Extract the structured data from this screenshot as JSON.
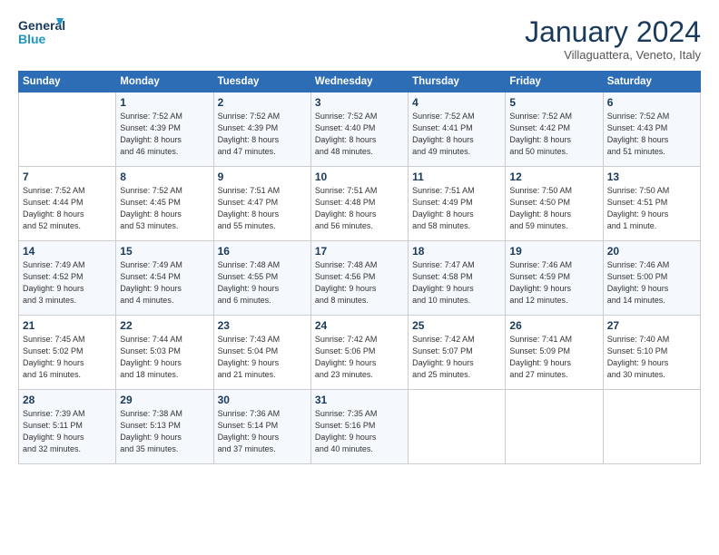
{
  "logo": {
    "line1": "General",
    "line2": "Blue"
  },
  "header": {
    "title": "January 2024",
    "subtitle": "Villaguattera, Veneto, Italy"
  },
  "weekdays": [
    "Sunday",
    "Monday",
    "Tuesday",
    "Wednesday",
    "Thursday",
    "Friday",
    "Saturday"
  ],
  "weeks": [
    [
      {
        "day": "",
        "info": ""
      },
      {
        "day": "1",
        "info": "Sunrise: 7:52 AM\nSunset: 4:39 PM\nDaylight: 8 hours\nand 46 minutes."
      },
      {
        "day": "2",
        "info": "Sunrise: 7:52 AM\nSunset: 4:39 PM\nDaylight: 8 hours\nand 47 minutes."
      },
      {
        "day": "3",
        "info": "Sunrise: 7:52 AM\nSunset: 4:40 PM\nDaylight: 8 hours\nand 48 minutes."
      },
      {
        "day": "4",
        "info": "Sunrise: 7:52 AM\nSunset: 4:41 PM\nDaylight: 8 hours\nand 49 minutes."
      },
      {
        "day": "5",
        "info": "Sunrise: 7:52 AM\nSunset: 4:42 PM\nDaylight: 8 hours\nand 50 minutes."
      },
      {
        "day": "6",
        "info": "Sunrise: 7:52 AM\nSunset: 4:43 PM\nDaylight: 8 hours\nand 51 minutes."
      }
    ],
    [
      {
        "day": "7",
        "info": "Sunrise: 7:52 AM\nSunset: 4:44 PM\nDaylight: 8 hours\nand 52 minutes."
      },
      {
        "day": "8",
        "info": "Sunrise: 7:52 AM\nSunset: 4:45 PM\nDaylight: 8 hours\nand 53 minutes."
      },
      {
        "day": "9",
        "info": "Sunrise: 7:51 AM\nSunset: 4:47 PM\nDaylight: 8 hours\nand 55 minutes."
      },
      {
        "day": "10",
        "info": "Sunrise: 7:51 AM\nSunset: 4:48 PM\nDaylight: 8 hours\nand 56 minutes."
      },
      {
        "day": "11",
        "info": "Sunrise: 7:51 AM\nSunset: 4:49 PM\nDaylight: 8 hours\nand 58 minutes."
      },
      {
        "day": "12",
        "info": "Sunrise: 7:50 AM\nSunset: 4:50 PM\nDaylight: 8 hours\nand 59 minutes."
      },
      {
        "day": "13",
        "info": "Sunrise: 7:50 AM\nSunset: 4:51 PM\nDaylight: 9 hours\nand 1 minute."
      }
    ],
    [
      {
        "day": "14",
        "info": "Sunrise: 7:49 AM\nSunset: 4:52 PM\nDaylight: 9 hours\nand 3 minutes."
      },
      {
        "day": "15",
        "info": "Sunrise: 7:49 AM\nSunset: 4:54 PM\nDaylight: 9 hours\nand 4 minutes."
      },
      {
        "day": "16",
        "info": "Sunrise: 7:48 AM\nSunset: 4:55 PM\nDaylight: 9 hours\nand 6 minutes."
      },
      {
        "day": "17",
        "info": "Sunrise: 7:48 AM\nSunset: 4:56 PM\nDaylight: 9 hours\nand 8 minutes."
      },
      {
        "day": "18",
        "info": "Sunrise: 7:47 AM\nSunset: 4:58 PM\nDaylight: 9 hours\nand 10 minutes."
      },
      {
        "day": "19",
        "info": "Sunrise: 7:46 AM\nSunset: 4:59 PM\nDaylight: 9 hours\nand 12 minutes."
      },
      {
        "day": "20",
        "info": "Sunrise: 7:46 AM\nSunset: 5:00 PM\nDaylight: 9 hours\nand 14 minutes."
      }
    ],
    [
      {
        "day": "21",
        "info": "Sunrise: 7:45 AM\nSunset: 5:02 PM\nDaylight: 9 hours\nand 16 minutes."
      },
      {
        "day": "22",
        "info": "Sunrise: 7:44 AM\nSunset: 5:03 PM\nDaylight: 9 hours\nand 18 minutes."
      },
      {
        "day": "23",
        "info": "Sunrise: 7:43 AM\nSunset: 5:04 PM\nDaylight: 9 hours\nand 21 minutes."
      },
      {
        "day": "24",
        "info": "Sunrise: 7:42 AM\nSunset: 5:06 PM\nDaylight: 9 hours\nand 23 minutes."
      },
      {
        "day": "25",
        "info": "Sunrise: 7:42 AM\nSunset: 5:07 PM\nDaylight: 9 hours\nand 25 minutes."
      },
      {
        "day": "26",
        "info": "Sunrise: 7:41 AM\nSunset: 5:09 PM\nDaylight: 9 hours\nand 27 minutes."
      },
      {
        "day": "27",
        "info": "Sunrise: 7:40 AM\nSunset: 5:10 PM\nDaylight: 9 hours\nand 30 minutes."
      }
    ],
    [
      {
        "day": "28",
        "info": "Sunrise: 7:39 AM\nSunset: 5:11 PM\nDaylight: 9 hours\nand 32 minutes."
      },
      {
        "day": "29",
        "info": "Sunrise: 7:38 AM\nSunset: 5:13 PM\nDaylight: 9 hours\nand 35 minutes."
      },
      {
        "day": "30",
        "info": "Sunrise: 7:36 AM\nSunset: 5:14 PM\nDaylight: 9 hours\nand 37 minutes."
      },
      {
        "day": "31",
        "info": "Sunrise: 7:35 AM\nSunset: 5:16 PM\nDaylight: 9 hours\nand 40 minutes."
      },
      {
        "day": "",
        "info": ""
      },
      {
        "day": "",
        "info": ""
      },
      {
        "day": "",
        "info": ""
      }
    ]
  ]
}
